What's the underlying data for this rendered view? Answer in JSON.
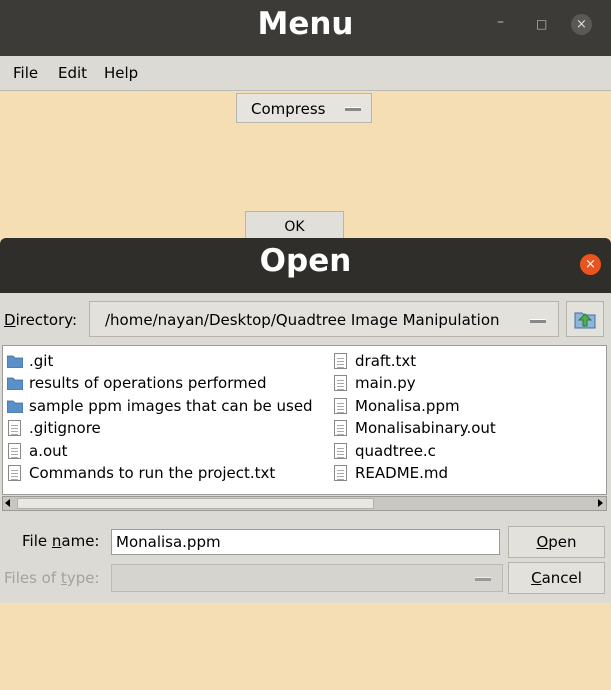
{
  "menu_window": {
    "title": "Menu",
    "window_controls": {
      "minimize": "–",
      "maximize": "□",
      "close": "×"
    },
    "menubar": [
      "File",
      "Edit",
      "Help"
    ],
    "compress_select": {
      "value": "Compress"
    },
    "ok_label": "OK"
  },
  "open_dialog": {
    "title": "Open",
    "close": "×",
    "directory": {
      "label_prefix": "D",
      "label_rest": "irectory:",
      "path": "/home/nayan/Desktop/Quadtree Image Manipulation"
    },
    "files_col1": [
      {
        "name": ".git",
        "icon": "folder-icon"
      },
      {
        "name": "results of operations performed",
        "icon": "folder-icon"
      },
      {
        "name": "sample ppm images that can be used",
        "icon": "folder-icon"
      },
      {
        "name": ".gitignore",
        "icon": "document-icon"
      },
      {
        "name": "a.out",
        "icon": "document-icon"
      },
      {
        "name": "Commands to run the project.txt",
        "icon": "document-icon"
      }
    ],
    "files_col2": [
      {
        "name": "draft.txt",
        "icon": "document-icon"
      },
      {
        "name": "main.py",
        "icon": "document-icon"
      },
      {
        "name": "Monalisa.ppm",
        "icon": "document-icon"
      },
      {
        "name": "Monalisabinary.out",
        "icon": "document-icon"
      },
      {
        "name": "quadtree.c",
        "icon": "document-icon"
      },
      {
        "name": "README.md",
        "icon": "document-icon"
      }
    ],
    "file_name": {
      "label_a": "File ",
      "label_ul": "n",
      "label_b": "ame:",
      "value": "Monalisa.ppm"
    },
    "files_of_type": {
      "label_a": "Files of ",
      "label_ul": "t",
      "label_b": "ype:"
    },
    "open_button": {
      "ul": "O",
      "rest": "pen"
    },
    "cancel_button": {
      "ul": "C",
      "rest": "ancel"
    },
    "colors": {
      "background": "#f5deb3",
      "titlebar": "#2f2e2b",
      "close_accent": "#e95420",
      "folder": "#5b8fc7"
    }
  }
}
